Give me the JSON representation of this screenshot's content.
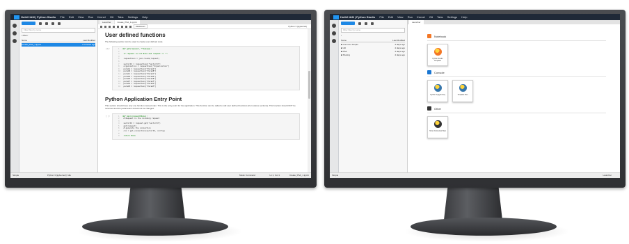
{
  "left_screen": {
    "app_title": "Hoth0 IAM | Python Studio",
    "menu": [
      "File",
      "Edit",
      "View",
      "Run",
      "Kernel",
      "Git",
      "Tabs",
      "Settings",
      "Help"
    ],
    "file_panel": {
      "search_placeholder": "Filter files by name",
      "breadcrumb": "/ PSA /",
      "columns": [
        "Name",
        "Last Modified"
      ],
      "files": [
        {
          "name": "Create_PSA_1.ipynb",
          "modified": "2 minutes ago",
          "selected": true
        }
      ]
    },
    "tabs": [
      "Launcher",
      "Create_PSA_1.ipynb"
    ],
    "toolbar": {
      "cell_type": "Markdown",
      "kernel": "Python 3 (ipykernel)"
    },
    "notebook": {
      "heading1": "User defined functions",
      "para1": "The following section can be used to create user defined code.",
      "cell1_prompt": "[1]:",
      "cell1_lines": [
        "def get(request, **kwargs):",
        "",
        "    if request is not None and request != \"\":",
        "",
        "        requestJson = json.loads(request)",
        "",
        "        sectorId = requestJson[\"SectorId\"]",
        "        organization = requestJson[\"Organization\"]",
        "        paramA = requestJson[\"ParamA\"]",
        "        paramB = requestJson[\"ParamB\"]",
        "        paramC = requestJson[\"ParamC\"]",
        "        paramD = requestJson[\"ParamD\"]",
        "        paramE = requestJson[\"ParamE\"]",
        "        paramF = requestJson[\"ParamF\"]",
        "        paramG = requestJson[\"ParamG\"]",
        "        paramH = requestJson[\"ParamH\"]"
      ],
      "heading2": "Python Application Entry Point",
      "para2": "This section should have only one function named main. This is the entry point for the application. This function can be called to call user defined functions (from above sections). This function should NOT be renamed and the parameters should not be changed.",
      "cell2_prompt": "[ ]:",
      "cell2_lines": [
        "def main(request=None):",
        "    # Request is the incoming request",
        "",
        "    sectorId = request.get(\"sectorId\")",
        "    get(request)",
        "    # generate the connection",
        "    cnx = get_connection(sectorId, config)",
        "",
        "    return None"
      ]
    },
    "status": {
      "left": "Simple",
      "kernel_info": "Python 3 (ipykernel) | Idle",
      "mode": "Mode: Command",
      "position": "Ln 1, Col 1",
      "file": "Create_PSA_1.ipynb"
    }
  },
  "right_screen": {
    "app_title": "Hoth0 IAM | Python Studio",
    "menu": [
      "File",
      "Edit",
      "View",
      "Run",
      "Kernel",
      "Git",
      "Tabs",
      "Settings",
      "Help"
    ],
    "file_panel": {
      "search_placeholder": "Filter files by name",
      "breadcrumb": "/",
      "columns": [
        "Name",
        "Last Modified"
      ],
      "folders": [
        {
          "name": "Common Scripts",
          "modified": "4 days ago"
        },
        {
          "name": "Util",
          "modified": "4 days ago"
        },
        {
          "name": "PSA",
          "modified": "4 days ago"
        },
        {
          "name": "Sharing",
          "modified": "4 days ago"
        }
      ]
    },
    "tabs": [
      "Launcher"
    ],
    "launcher": {
      "sections": [
        {
          "title": "Notebook",
          "icon_color": "#f37726",
          "cards": [
            {
              "label": "Python Studio Template",
              "icon_color": "#f37726"
            }
          ]
        },
        {
          "title": "Console",
          "icon_color": "#1976d2",
          "cards": [
            {
              "label": "Python 3 (ipykernel)",
              "icon_color": "#3776ab"
            },
            {
              "label": "Template Run",
              "icon_color": "#3776ab"
            }
          ]
        },
        {
          "title": "Other",
          "icon_color": "#333333",
          "cards": [
            {
              "label": "Show Contextual Help",
              "icon_color": "#333333"
            }
          ]
        }
      ]
    },
    "status": {
      "left": "Simple",
      "right": "Launcher"
    }
  }
}
